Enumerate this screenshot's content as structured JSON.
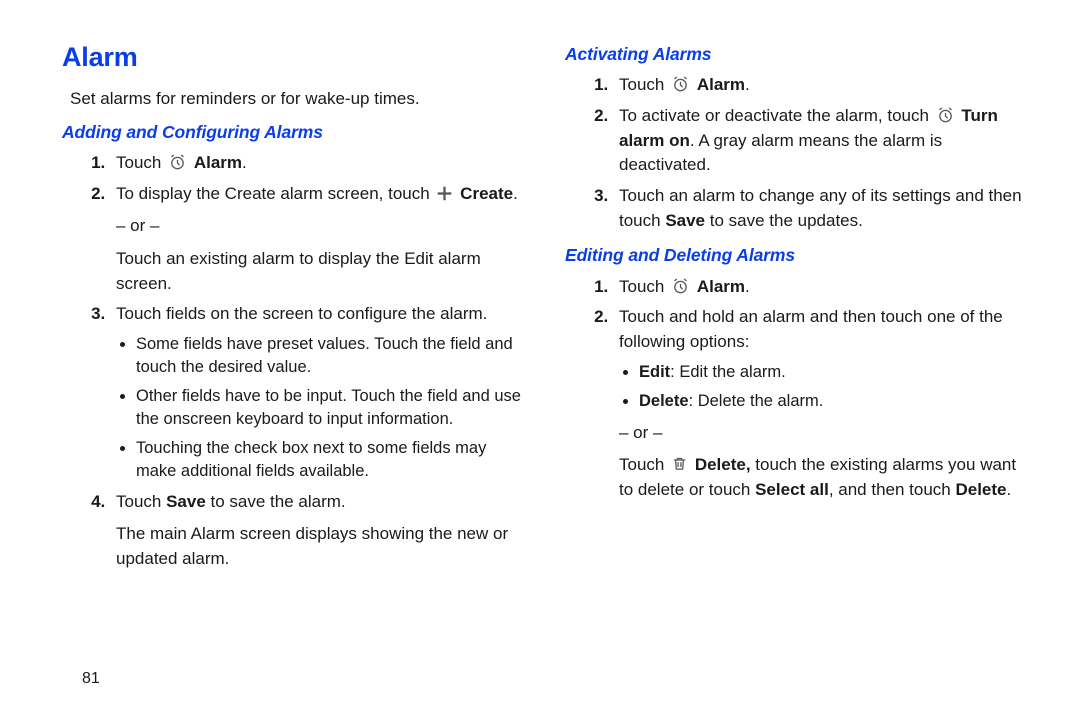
{
  "title": "Alarm",
  "intro": "Set alarms for reminders or for wake-up times.",
  "left": {
    "sub1": "Adding and Configuring Alarms",
    "steps": {
      "s1_pre": "Touch ",
      "s1_label": "Alarm",
      "s1_post": ".",
      "s2_pre": "To display the Create alarm screen, touch ",
      "s2_label": "Create",
      "s2_post": ".",
      "s2_or": "– or –",
      "s2_cont": "Touch an existing alarm to display the Edit alarm screen.",
      "s3": "Touch fields on the screen to configure the alarm.",
      "s3_b1": "Some fields have preset values. Touch the field and touch the desired value.",
      "s3_b2": "Other fields have to be input. Touch the field and use the onscreen keyboard to input information.",
      "s3_b3": "Touching the check box next to some fields may make additional fields available.",
      "s4_pre": "Touch ",
      "s4_bold": "Save",
      "s4_post": " to save the alarm.",
      "s4_cont": "The main Alarm screen displays showing the new or updated alarm."
    }
  },
  "right": {
    "sub2": "Activating Alarms",
    "act": {
      "s1_pre": "Touch ",
      "s1_label": "Alarm",
      "s1_post": ".",
      "s2_pre": "To activate or deactivate the alarm, touch ",
      "s2_bold1": "Turn alarm on",
      "s2_post": ". A gray alarm means the alarm is deactivated.",
      "s3_pre": "Touch an alarm to change any of its settings and then touch ",
      "s3_bold": "Save",
      "s3_post": " to save the updates."
    },
    "sub3": "Editing and Deleting Alarms",
    "edit": {
      "s1_pre": "Touch ",
      "s1_label": "Alarm",
      "s1_post": ".",
      "s2": "Touch and hold an alarm and then touch one of the following options:",
      "b1_bold": "Edit",
      "b1_post": ": Edit the alarm.",
      "b2_bold": "Delete",
      "b2_post": ": Delete the alarm.",
      "or": "– or –",
      "tail_pre": "Touch ",
      "tail_bold1": "Delete,",
      "tail_mid": " touch the existing alarms you want to delete or touch ",
      "tail_bold2": "Select all",
      "tail_mid2": ", and then touch ",
      "tail_bold3": "Delete",
      "tail_post": "."
    }
  },
  "page_number": "81"
}
